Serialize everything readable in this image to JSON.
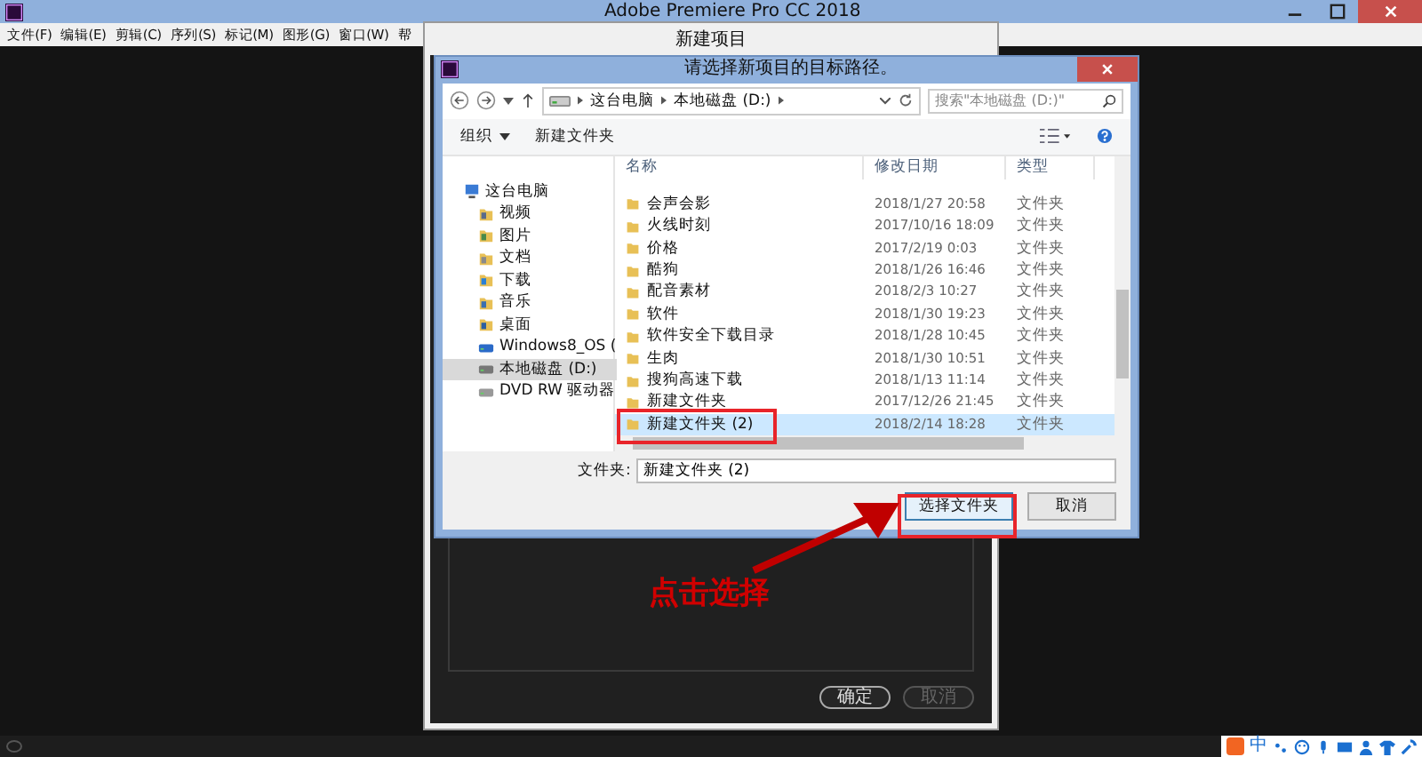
{
  "app": {
    "title": "Adobe Premiere Pro CC 2018",
    "menu": [
      "文件(F)",
      "编辑(E)",
      "剪辑(C)",
      "序列(S)",
      "标记(M)",
      "图形(G)",
      "窗口(W)",
      "帮"
    ]
  },
  "new_project_dialog": {
    "title": "新建项目",
    "buttons": [
      {
        "label": "确定",
        "disabled": false
      },
      {
        "label": "取消",
        "disabled": true
      }
    ]
  },
  "folder_dialog": {
    "title": "请选择新项目的目标路径。",
    "breadcrumb": [
      "这台电脑",
      "本地磁盘 (D:)"
    ],
    "search": {
      "placeholder": "搜索\"本地磁盘 (D:)\""
    },
    "organize": "组织",
    "new_folder": "新建文件夹",
    "sidebar": [
      {
        "label": "这台电脑",
        "kind": "pc",
        "selected": false,
        "children": [
          {
            "label": "视频",
            "kind": "video",
            "selected": false
          },
          {
            "label": "图片",
            "kind": "pictures",
            "selected": false
          },
          {
            "label": "文档",
            "kind": "docs",
            "selected": false
          },
          {
            "label": "下载",
            "kind": "downloads",
            "selected": false
          },
          {
            "label": "音乐",
            "kind": "music",
            "selected": false
          },
          {
            "label": "桌面",
            "kind": "desktop",
            "selected": false
          },
          {
            "label": "Windows8_OS (",
            "kind": "system",
            "selected": false
          },
          {
            "label": "本地磁盘 (D:)",
            "kind": "drive",
            "selected": true
          },
          {
            "label": "DVD RW 驱动器",
            "kind": "dvd",
            "selected": false
          }
        ]
      }
    ],
    "columns": [
      "名称",
      "修改日期",
      "类型"
    ],
    "rows": [
      {
        "name": "会声会影",
        "date": "2018/1/27 20:58",
        "type": "文件夹",
        "selected": false
      },
      {
        "name": "火线时刻",
        "date": "2017/10/16 18:09",
        "type": "文件夹",
        "selected": false
      },
      {
        "name": "价格",
        "date": "2017/2/19 0:03",
        "type": "文件夹",
        "selected": false
      },
      {
        "name": "酷狗",
        "date": "2018/1/26 16:46",
        "type": "文件夹",
        "selected": false
      },
      {
        "name": "配音素材",
        "date": "2018/2/3 10:27",
        "type": "文件夹",
        "selected": false
      },
      {
        "name": "软件",
        "date": "2018/1/30 19:23",
        "type": "文件夹",
        "selected": false
      },
      {
        "name": "软件安全下载目录",
        "date": "2018/1/28 10:45",
        "type": "文件夹",
        "selected": false
      },
      {
        "name": "生肉",
        "date": "2018/1/30 10:51",
        "type": "文件夹",
        "selected": false
      },
      {
        "name": "搜狗高速下载",
        "date": "2018/1/13 11:14",
        "type": "文件夹",
        "selected": false
      },
      {
        "name": "新建文件夹",
        "date": "2017/12/26 21:45",
        "type": "文件夹",
        "selected": false
      },
      {
        "name": "新建文件夹 (2)",
        "date": "2018/2/14 18:28",
        "type": "文件夹",
        "selected": true
      }
    ],
    "folder_label": "文件夹:",
    "folder_value": "新建文件夹 (2)",
    "buttons": [
      "选择文件夹",
      "取消"
    ]
  },
  "annotation": {
    "text": "点击选择"
  },
  "ime": {
    "mode": "中"
  }
}
